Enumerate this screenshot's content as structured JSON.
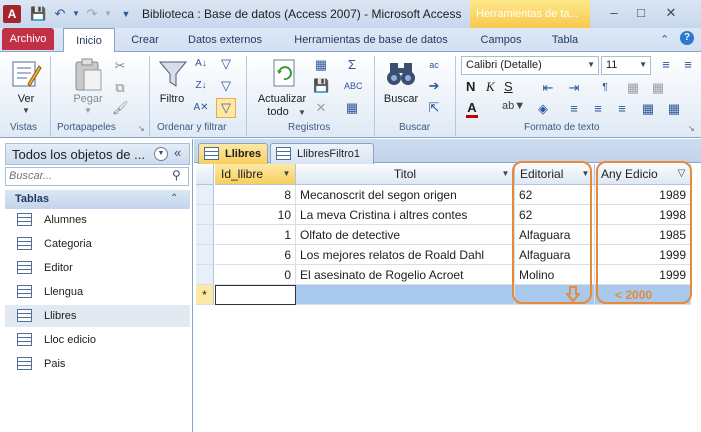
{
  "window": {
    "title": "Biblioteca : Base de datos (Access 2007)  -  Microsoft Access",
    "context_tab": "Herramientas de ta...",
    "app_icon": "A"
  },
  "ribbon_tabs": {
    "file": "Archivo",
    "items": [
      "Inicio",
      "Crear",
      "Datos externos",
      "Herramientas de base de datos",
      "Campos",
      "Tabla"
    ]
  },
  "ribbon": {
    "vistas": {
      "ver_label": "Ver",
      "group": "Vistas"
    },
    "portapapeles": {
      "pegar_label": "Pegar",
      "group": "Portapapeles"
    },
    "ordenar": {
      "filtro_label": "Filtro",
      "group": "Ordenar y filtrar"
    },
    "registros": {
      "actualizar_label": "Actualizar",
      "todo_label": "todo",
      "group": "Registros"
    },
    "buscar": {
      "buscar_label": "Buscar",
      "group": "Buscar"
    },
    "formato": {
      "font_name": "Calibri (Detalle)",
      "font_size": "11",
      "group": "Formato de texto"
    }
  },
  "nav": {
    "header": "Todos los objetos de ...",
    "search_placeholder": "Buscar...",
    "section": "Tablas",
    "items": [
      "Alumnes",
      "Categoria",
      "Editor",
      "Llengua",
      "Llibres",
      "Lloc edicio",
      "Pais"
    ],
    "selected": "Llibres"
  },
  "doc_tabs": [
    "Llibres",
    "LlibresFiltro1"
  ],
  "table": {
    "columns": [
      "Id_llibre",
      "Titol",
      "Editorial",
      "Any Edicio"
    ],
    "rows": [
      [
        "8",
        "Mecanoscrit del segon origen",
        "62",
        "1989"
      ],
      [
        "10",
        "La meva Cristina i altres contes",
        "62",
        "1998"
      ],
      [
        "1",
        "Olfato de detective",
        "Alfaguara",
        "1985"
      ],
      [
        "6",
        "Los mejores relatos de Roald Dahl",
        "Alfaguara",
        "1999"
      ],
      [
        "0",
        "El asesinato de Rogelio Acroet",
        "Molino",
        "1999"
      ]
    ],
    "new_row_marker": "*",
    "filter_hint": "< 2000"
  },
  "colors": {
    "highlight": "#e8883a",
    "file_tab": "#c23045",
    "accent": "#2b579a"
  }
}
